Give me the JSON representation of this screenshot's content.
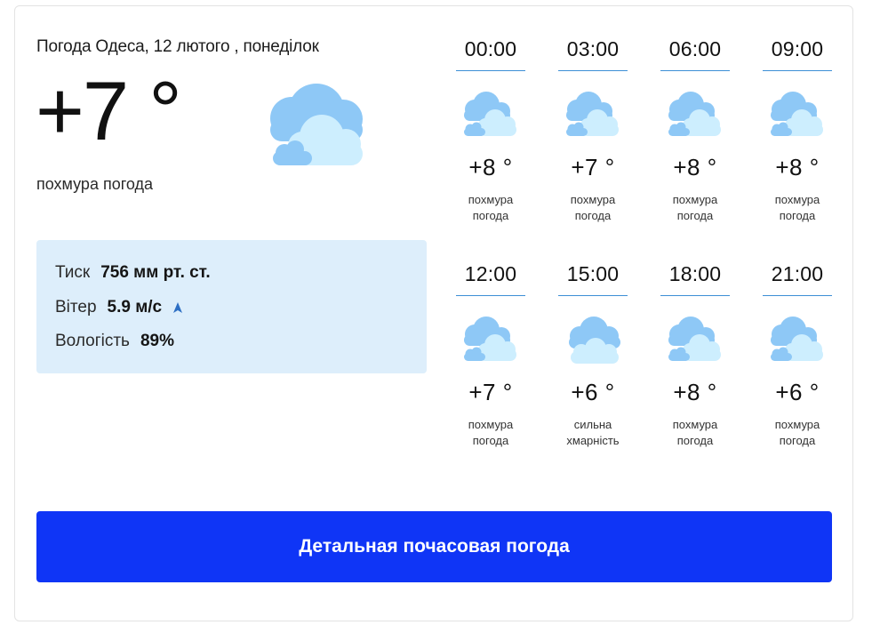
{
  "widget": {
    "title": "Погода Одеса, 12 лютого , понеділок",
    "current_temp": "+7 °",
    "current_condition": "похмура погода",
    "current_icon": "cloudy-icon"
  },
  "details": {
    "pressure_label": "Тиск",
    "pressure_value": "756 мм рт. ст.",
    "wind_label": "Вітер",
    "wind_value": "5.9 м/с",
    "humidity_label": "Вологість",
    "humidity_value": "89%"
  },
  "hourly": [
    {
      "time": "00:00",
      "temp": "+8 °",
      "cond1": "похмура",
      "cond2": "погода",
      "icon": "overcast-icon"
    },
    {
      "time": "03:00",
      "temp": "+7 °",
      "cond1": "похмура",
      "cond2": "погода",
      "icon": "overcast-icon"
    },
    {
      "time": "06:00",
      "temp": "+8 °",
      "cond1": "похмура",
      "cond2": "погода",
      "icon": "overcast-icon"
    },
    {
      "time": "09:00",
      "temp": "+8 °",
      "cond1": "похмура",
      "cond2": "погода",
      "icon": "overcast-icon"
    },
    {
      "time": "12:00",
      "temp": "+7 °",
      "cond1": "похмура",
      "cond2": "погода",
      "icon": "overcast-icon"
    },
    {
      "time": "15:00",
      "temp": "+6 °",
      "cond1": "сильна",
      "cond2": "хмарність",
      "icon": "cloudy-icon"
    },
    {
      "time": "18:00",
      "temp": "+8 °",
      "cond1": "похмура",
      "cond2": "погода",
      "icon": "overcast-icon"
    },
    {
      "time": "21:00",
      "temp": "+6 °",
      "cond1": "похмура",
      "cond2": "погода",
      "icon": "overcast-icon"
    }
  ],
  "button": {
    "label": "Детальная почасовая погода"
  },
  "colors": {
    "accent": "#0f35f6",
    "details_bg": "#ddeefb",
    "cloud_light": "#cdeefe",
    "cloud_blue": "#8ec8f6",
    "hour_underline": "#3d8fd6"
  }
}
